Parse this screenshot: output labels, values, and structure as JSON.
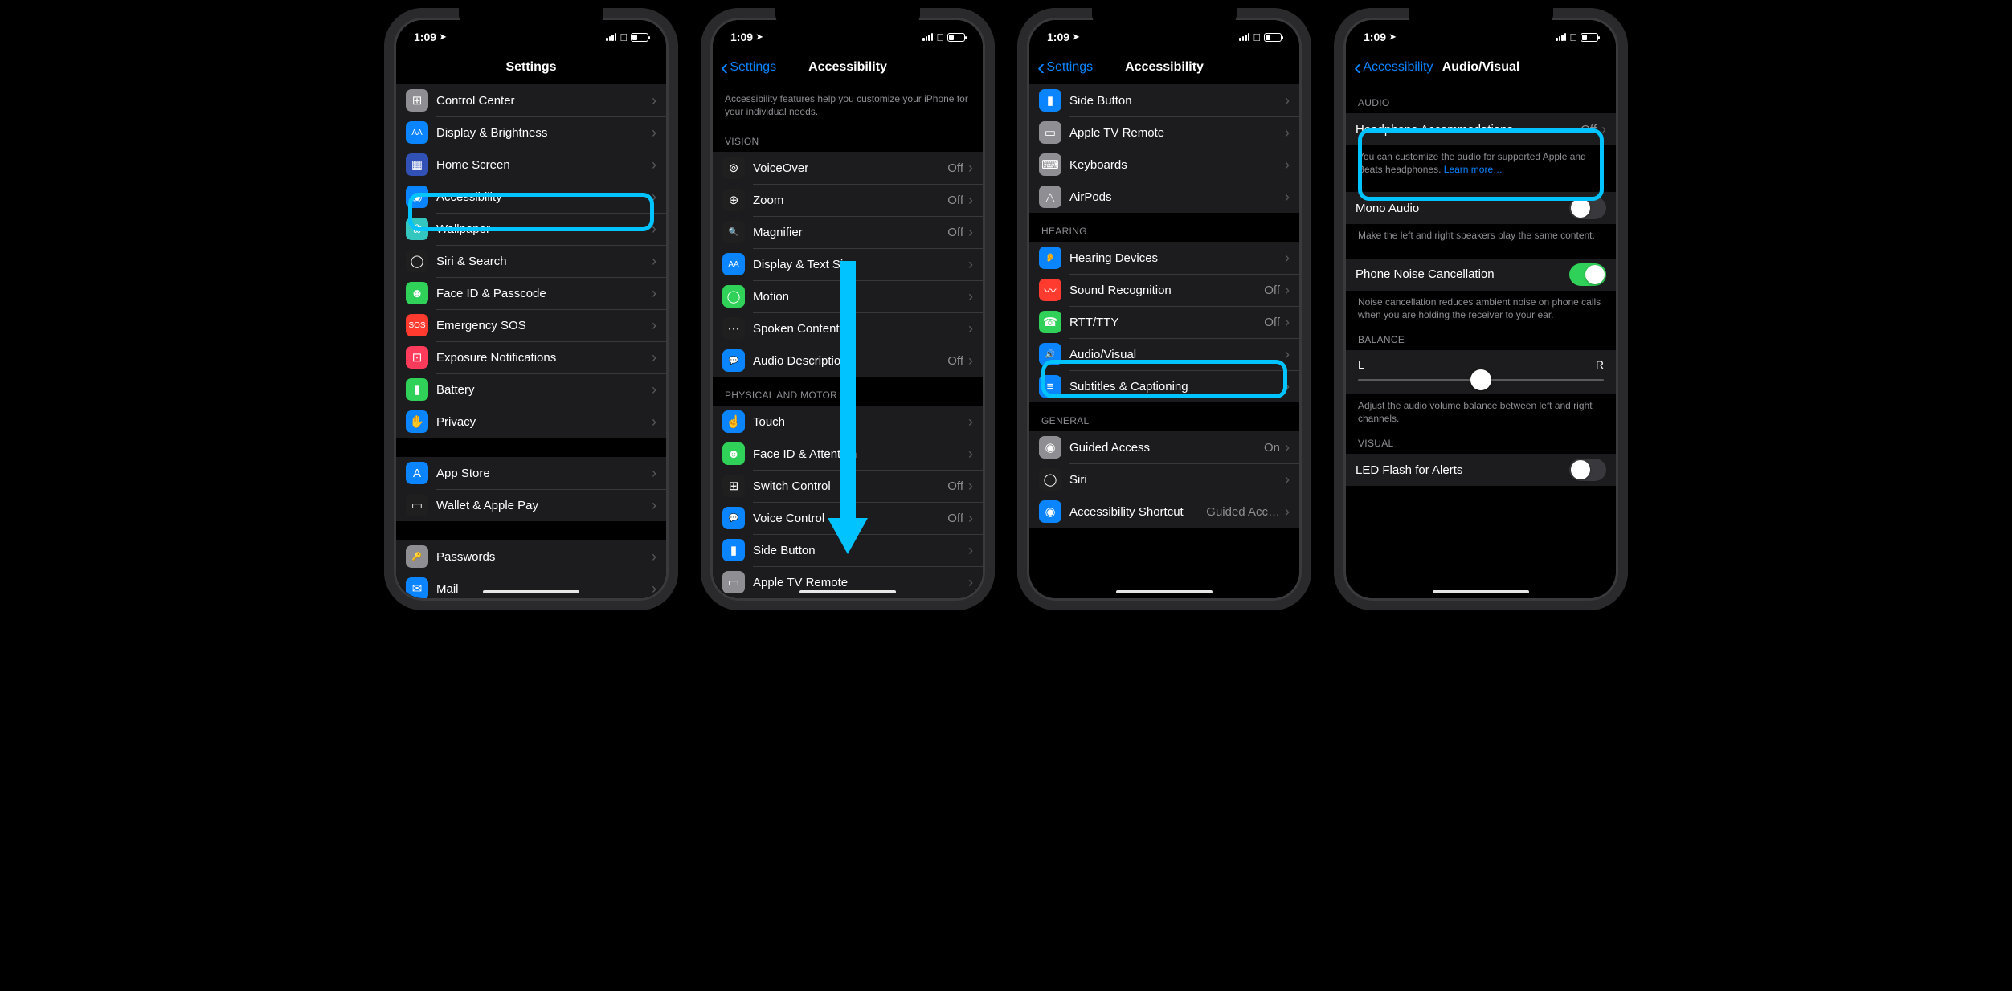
{
  "status": {
    "time": "1:09",
    "location_arrow": "➤"
  },
  "screen1": {
    "title": "Settings",
    "rows": [
      {
        "icon": "⊞",
        "bg": "#8e8e93",
        "label": "Control Center"
      },
      {
        "icon": "AA",
        "bg": "#0a84ff",
        "label": "Display & Brightness"
      },
      {
        "icon": "▦",
        "bg": "#3151b7",
        "label": "Home Screen"
      },
      {
        "icon": "◉",
        "bg": "#0a84ff",
        "label": "Accessibility",
        "highlighted": true
      },
      {
        "icon": "❀",
        "bg": "#34c7c0",
        "label": "Wallpaper"
      },
      {
        "icon": "◯",
        "bg": "#1f1f1f",
        "label": "Siri & Search"
      },
      {
        "icon": "☻",
        "bg": "#30d158",
        "label": "Face ID & Passcode"
      },
      {
        "icon": "SOS",
        "bg": "#ff3b30",
        "label": "Emergency SOS"
      },
      {
        "icon": "⊡",
        "bg": "#ff3b5c",
        "label": "Exposure Notifications"
      },
      {
        "icon": "▮",
        "bg": "#30d158",
        "label": "Battery"
      },
      {
        "icon": "✋",
        "bg": "#0a84ff",
        "label": "Privacy"
      }
    ],
    "group2": [
      {
        "icon": "A",
        "bg": "#0a84ff",
        "label": "App Store"
      },
      {
        "icon": "▭",
        "bg": "#1f1f1f",
        "label": "Wallet & Apple Pay"
      }
    ],
    "group3": [
      {
        "icon": "🔑",
        "bg": "#8e8e93",
        "label": "Passwords"
      },
      {
        "icon": "✉",
        "bg": "#0a84ff",
        "label": "Mail"
      }
    ]
  },
  "screen2": {
    "back": "Settings",
    "title": "Accessibility",
    "intro": "Accessibility features help you customize your iPhone for your individual needs.",
    "sections": {
      "vision_header": "VISION",
      "vision": [
        {
          "icon": "⊚",
          "bg": "#1f1f1f",
          "label": "VoiceOver",
          "value": "Off"
        },
        {
          "icon": "⊕",
          "bg": "#1f1f1f",
          "label": "Zoom",
          "value": "Off"
        },
        {
          "icon": "🔍",
          "bg": "#1f1f1f",
          "label": "Magnifier",
          "value": "Off"
        },
        {
          "icon": "AA",
          "bg": "#0a84ff",
          "label": "Display & Text Size"
        },
        {
          "icon": "◯",
          "bg": "#30d158",
          "label": "Motion"
        },
        {
          "icon": "⋯",
          "bg": "#1f1f1f",
          "label": "Spoken Content"
        },
        {
          "icon": "💬",
          "bg": "#0a84ff",
          "label": "Audio Descriptions",
          "value": "Off"
        }
      ],
      "motor_header": "PHYSICAL AND MOTOR",
      "motor": [
        {
          "icon": "☝",
          "bg": "#0a84ff",
          "label": "Touch"
        },
        {
          "icon": "☻",
          "bg": "#30d158",
          "label": "Face ID & Attention"
        },
        {
          "icon": "⊞",
          "bg": "#1f1f1f",
          "label": "Switch Control",
          "value": "Off"
        },
        {
          "icon": "💬",
          "bg": "#0a84ff",
          "label": "Voice Control",
          "value": "Off"
        },
        {
          "icon": "▮",
          "bg": "#0a84ff",
          "label": "Side Button"
        },
        {
          "icon": "▭",
          "bg": "#8e8e93",
          "label": "Apple TV Remote"
        }
      ]
    }
  },
  "screen3": {
    "back": "Settings",
    "title": "Accessibility",
    "top": [
      {
        "icon": "▮",
        "bg": "#0a84ff",
        "label": "Side Button"
      },
      {
        "icon": "▭",
        "bg": "#8e8e93",
        "label": "Apple TV Remote"
      },
      {
        "icon": "⌨",
        "bg": "#8e8e93",
        "label": "Keyboards"
      },
      {
        "icon": "△",
        "bg": "#8e8e93",
        "label": "AirPods"
      }
    ],
    "hearing_header": "HEARING",
    "hearing": [
      {
        "icon": "👂",
        "bg": "#0a84ff",
        "label": "Hearing Devices"
      },
      {
        "icon": "〰",
        "bg": "#ff3b30",
        "label": "Sound Recognition",
        "value": "Off"
      },
      {
        "icon": "☎",
        "bg": "#30d158",
        "label": "RTT/TTY",
        "value": "Off"
      },
      {
        "icon": "🔊",
        "bg": "#0a84ff",
        "label": "Audio/Visual",
        "highlighted": true
      },
      {
        "icon": "≡",
        "bg": "#0a84ff",
        "label": "Subtitles & Captioning"
      }
    ],
    "general_header": "GENERAL",
    "general": [
      {
        "icon": "◉",
        "bg": "#8e8e93",
        "label": "Guided Access",
        "value": "On"
      },
      {
        "icon": "◯",
        "bg": "#1f1f1f",
        "label": "Siri"
      },
      {
        "icon": "◉",
        "bg": "#0a84ff",
        "label": "Accessibility Shortcut",
        "value": "Guided Acc…"
      }
    ]
  },
  "screen4": {
    "back": "Accessibility",
    "title": "Audio/Visual",
    "audio_header": "AUDIO",
    "headphone": {
      "label": "Headphone Accommodations",
      "value": "Off"
    },
    "headphone_footer": "You can customize the audio for supported Apple and Beats headphones.",
    "learn_more": "Learn more…",
    "mono": {
      "label": "Mono Audio"
    },
    "mono_footer": "Make the left and right speakers play the same content.",
    "noise": {
      "label": "Phone Noise Cancellation"
    },
    "noise_footer": "Noise cancellation reduces ambient noise on phone calls when you are holding the receiver to your ear.",
    "balance_header": "BALANCE",
    "balance": {
      "left": "L",
      "right": "R"
    },
    "balance_footer": "Adjust the audio volume balance between left and right channels.",
    "visual_header": "VISUAL",
    "led": {
      "label": "LED Flash for Alerts"
    }
  }
}
